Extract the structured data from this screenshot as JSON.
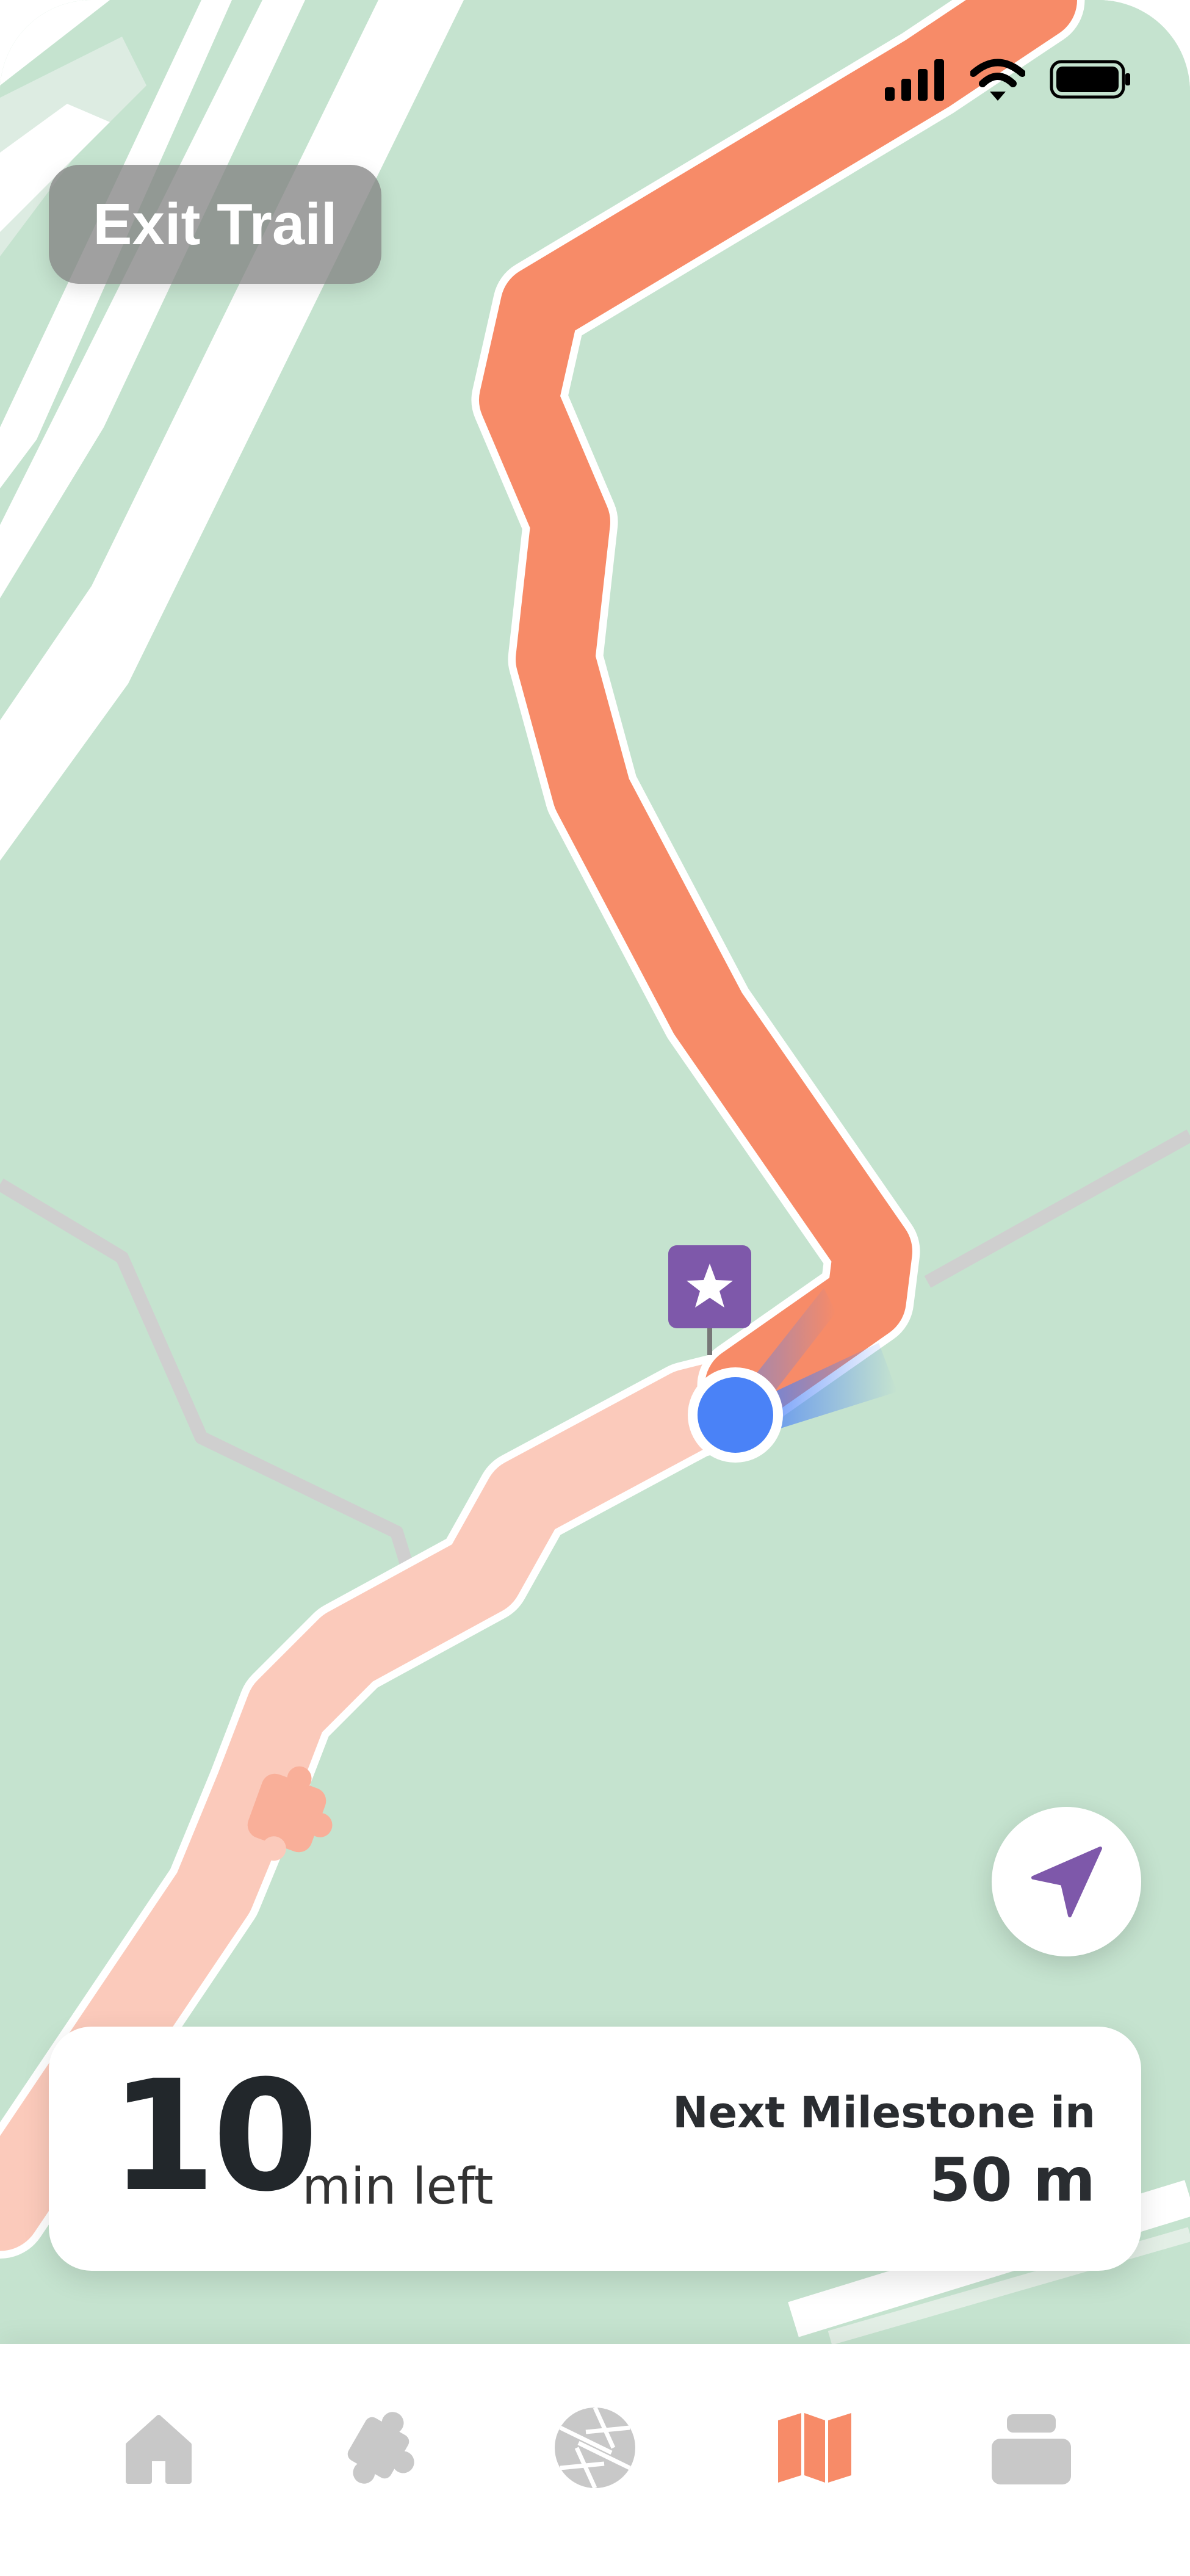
{
  "status_bar": {
    "signal_icon": "signal-bars-icon",
    "wifi_icon": "wifi-icon",
    "battery_icon": "battery-icon"
  },
  "header": {
    "exit_label": "Exit Trail"
  },
  "map": {
    "route_color": "#f78b68",
    "completed_route_color": "#fbcabb",
    "background_color": "#c5e3cf",
    "location_dot_color": "#4a82f7",
    "milestone_marker_icon": "star-icon",
    "milestone_marker_color": "#7e58aa",
    "puzzle_marker_icon": "puzzle-piece-icon"
  },
  "locate_button": {
    "icon": "navigation-arrow-icon",
    "color": "#7e58aa"
  },
  "info_card": {
    "minutes": "10",
    "minutes_label": "min left",
    "next_label": "Next Milestone in",
    "next_distance": "50 m"
  },
  "tabs": [
    {
      "name": "home",
      "icon": "home-icon",
      "active": false
    },
    {
      "name": "puzzles",
      "icon": "puzzle-icon",
      "active": false
    },
    {
      "name": "camera",
      "icon": "aperture-icon",
      "active": false
    },
    {
      "name": "map",
      "icon": "map-icon",
      "active": true
    },
    {
      "name": "collection",
      "icon": "stack-icon",
      "active": false
    }
  ],
  "colors": {
    "accent": "#f78b68",
    "inactive_icon": "#c8c8c8",
    "purple": "#7e58aa"
  }
}
